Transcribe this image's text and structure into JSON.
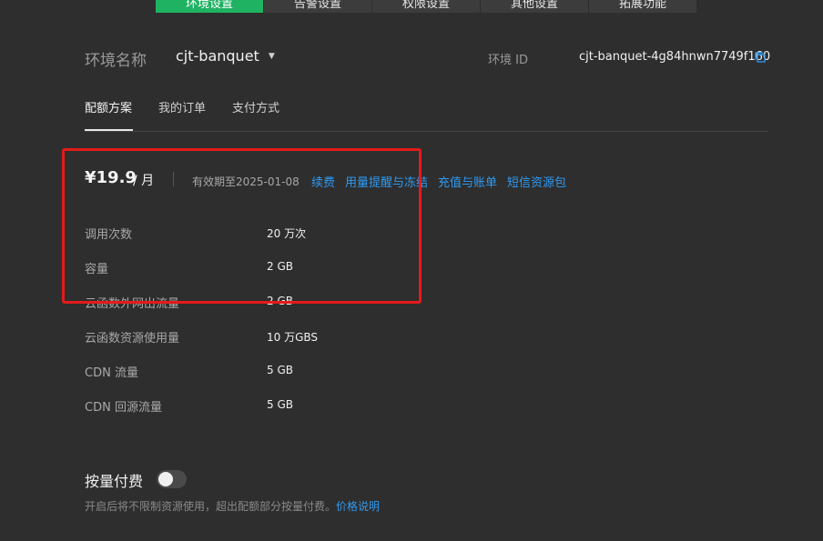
{
  "top_tabs": [
    "环境设置",
    "告警设置",
    "权限设置",
    "其他设置",
    "拓展功能"
  ],
  "env": {
    "name_label": "环境名称",
    "name_value": "cjt-banquet",
    "id_label": "环境 ID",
    "id_value": "cjt-banquet-4g84hnwn7749f160"
  },
  "subtabs": [
    "配额方案",
    "我的订单",
    "支付方式"
  ],
  "plan": {
    "price": "¥19.9",
    "unit": "/ 月",
    "valid_until": "有效期至2025-01-08",
    "links": [
      "续费",
      "用量提醒与冻结",
      "充值与账单",
      "短信资源包"
    ]
  },
  "quota_rows": [
    {
      "label": "调用次数",
      "value": "20 万次"
    },
    {
      "label": "容量",
      "value": "2 GB"
    },
    {
      "label": "云函数外网出流量",
      "value": "2 GB"
    },
    {
      "label": "云函数资源使用量",
      "value": "10 万GBS"
    },
    {
      "label": "CDN 流量",
      "value": "5 GB"
    },
    {
      "label": "CDN 回源流量",
      "value": "5 GB"
    }
  ],
  "payg": {
    "label": "按量付费",
    "toggle_on": false,
    "description": "开启后将不限制资源使用，超出配额部分按量付费。",
    "link": "价格说明"
  },
  "colors": {
    "accent_green": "#1fb262",
    "link_blue": "#2f9af2",
    "highlight_red": "#e31b1b"
  }
}
